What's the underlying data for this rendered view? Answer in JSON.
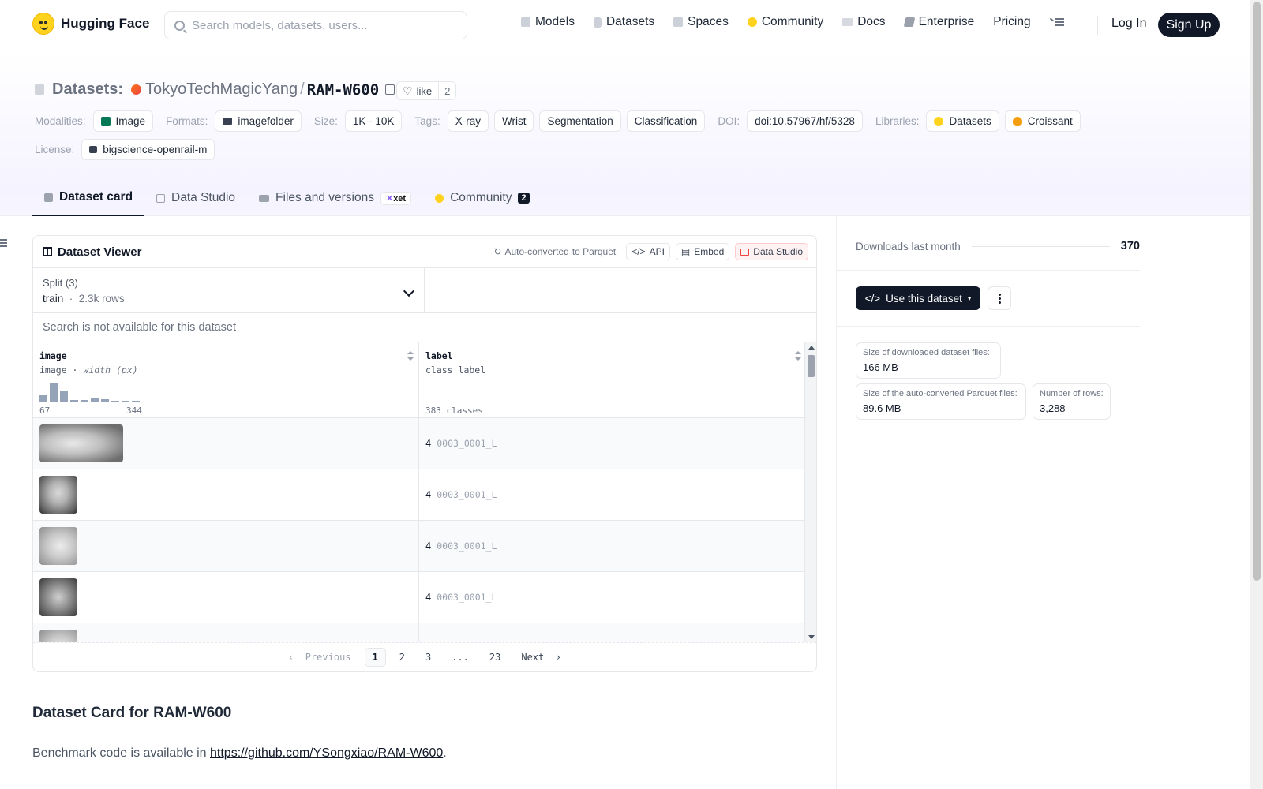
{
  "nav": {
    "brand": "Hugging Face",
    "search_placeholder": "Search models, datasets, users...",
    "links": [
      {
        "label": "Models",
        "icon": "cube-icon"
      },
      {
        "label": "Datasets",
        "icon": "database-icon"
      },
      {
        "label": "Spaces",
        "icon": "grid-icon"
      },
      {
        "label": "Community",
        "icon": "hf-icon"
      },
      {
        "label": "Docs",
        "icon": "book-icon"
      },
      {
        "label": "Enterprise",
        "icon": "enterprise-icon"
      },
      {
        "label": "Pricing",
        "icon": ""
      }
    ],
    "login": "Log In",
    "signup": "Sign Up"
  },
  "header": {
    "kind": "Datasets:",
    "org": "TokyoTechMagicYang",
    "sep": "/",
    "name": "RAM-W600",
    "like_label": "like",
    "like_count": "2",
    "modalities_label": "Modalities:",
    "modalities": [
      "Image"
    ],
    "formats_label": "Formats:",
    "formats": [
      "imagefolder"
    ],
    "size_label": "Size:",
    "size": "1K - 10K",
    "tags_label": "Tags:",
    "tags": [
      "X-ray",
      "Wrist",
      "Segmentation",
      "Classification"
    ],
    "doi_label": "DOI:",
    "doi": "doi:10.57967/hf/5328",
    "libraries_label": "Libraries:",
    "libraries": [
      "Datasets",
      "Croissant"
    ],
    "license_label": "License:",
    "license": "bigscience-openrail-m"
  },
  "tabs": [
    {
      "label": "Dataset card",
      "active": true
    },
    {
      "label": "Data Studio"
    },
    {
      "label": "Files and versions",
      "badge": "xet"
    },
    {
      "label": "Community",
      "count": "2"
    }
  ],
  "viewer": {
    "title": "Dataset Viewer",
    "autoconverted": "Auto-converted",
    "to_parquet": "to Parquet",
    "api": "API",
    "embed": "Embed",
    "data_studio": "Data Studio",
    "split_label": "Split (3)",
    "split_name": "train",
    "split_rows": "2.3k rows",
    "search_na": "Search is not available for this dataset",
    "columns": [
      {
        "name": "image",
        "type": "image",
        "type_note": "width (px)",
        "min": "67",
        "max": "344"
      },
      {
        "name": "label",
        "type": "class label",
        "classes": "383 classes"
      }
    ],
    "histogram": [
      0.35,
      0.95,
      0.55,
      0.1,
      0.1,
      0.2,
      0.15,
      0.08,
      0.08,
      0.05
    ],
    "rows": [
      {
        "label_id": "4",
        "label_name": "0003_0001_L"
      },
      {
        "label_id": "4",
        "label_name": "0003_0001_L"
      },
      {
        "label_id": "4",
        "label_name": "0003_0001_L"
      },
      {
        "label_id": "4",
        "label_name": "0003_0001_L"
      }
    ],
    "pager": {
      "prev": "Previous",
      "pages": [
        "1",
        "2",
        "3",
        "...",
        "23"
      ],
      "next": "Next"
    }
  },
  "card": {
    "title": "Dataset Card for RAM-W600",
    "text_prefix": "Benchmark code is available in ",
    "link": "https://github.com/YSongxiao/RAM-W600",
    "text_suffix": "."
  },
  "sidebar": {
    "downloads_label": "Downloads last month",
    "downloads": "370",
    "use_button": "Use this dataset",
    "stats": [
      {
        "label": "Size of downloaded dataset files:",
        "value": "166 MB"
      },
      {
        "label": "Size of the auto-converted Parquet files:",
        "value": "89.6 MB"
      },
      {
        "label": "Number of rows:",
        "value": "3,288"
      }
    ]
  }
}
